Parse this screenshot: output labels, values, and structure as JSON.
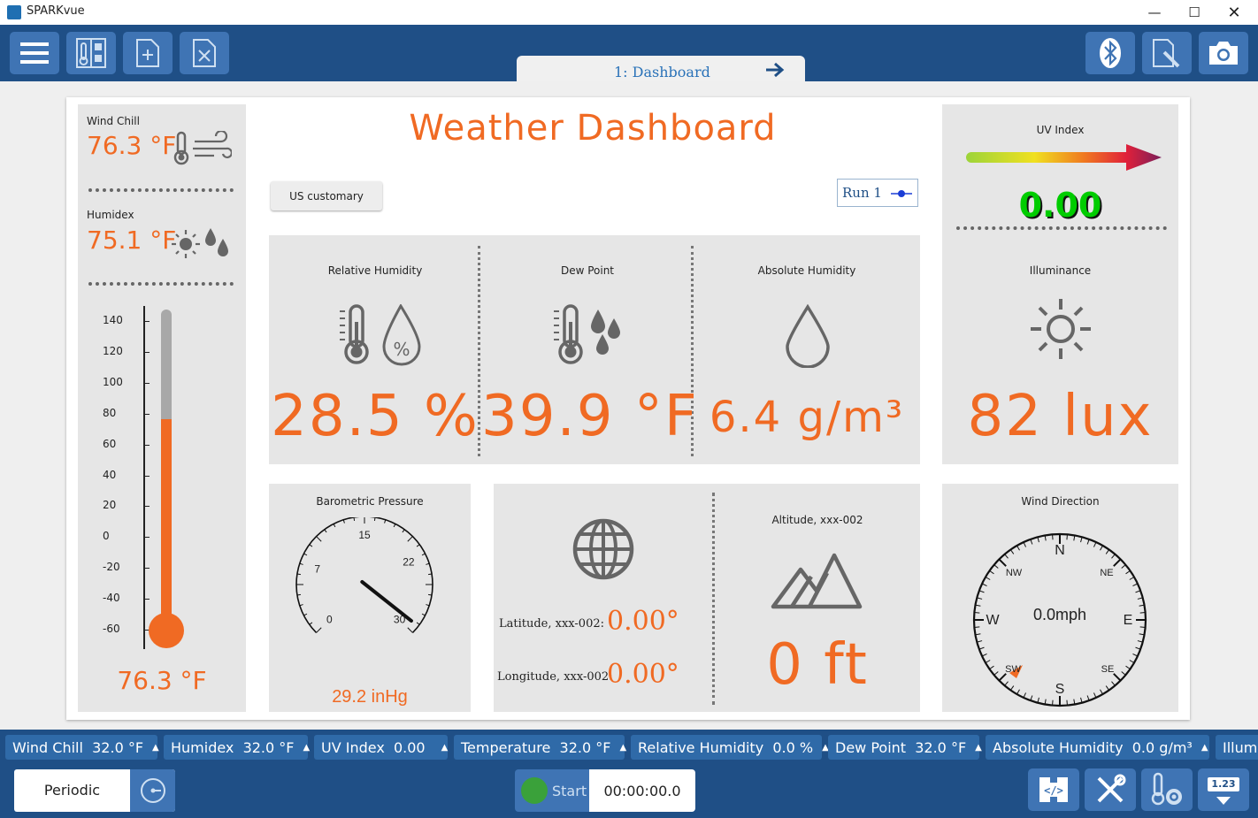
{
  "window": {
    "title": "SPARKvue"
  },
  "page_tab": {
    "label": "1: Dashboard"
  },
  "dashboard": {
    "title": "Weather Dashboard",
    "units_button": "US customary",
    "run_label": "Run 1"
  },
  "wind_chill": {
    "label": "Wind Chill",
    "value": "76.3 °F"
  },
  "humidex": {
    "label": "Humidex",
    "value": "75.1 °F"
  },
  "thermometer": {
    "ticks": [
      "140",
      "120",
      "100",
      "80",
      "60",
      "40",
      "20",
      "0",
      "-20",
      "-40",
      "-60"
    ],
    "fill_value": 76.3,
    "range": [
      -60,
      140
    ],
    "value": "76.3 °F"
  },
  "relative_humidity": {
    "label": "Relative Humidity",
    "value": "28.5 %"
  },
  "dew_point": {
    "label": "Dew Point",
    "value": "39.9 °F"
  },
  "absolute_humidity": {
    "label": "Absolute Humidity",
    "value": "6.4 g/m³"
  },
  "uv_index": {
    "label": "UV Index",
    "value": "0.00"
  },
  "illuminance": {
    "label": "Illuminance",
    "value": "82 lux"
  },
  "barometric": {
    "label": "Barometric Pressure",
    "ticks": [
      "0",
      "7",
      "15",
      "22",
      "30"
    ],
    "value": "29.2 inHg",
    "needle_value": 29.2,
    "range": [
      0,
      30
    ]
  },
  "location": {
    "latitude_label": "Latitude, xxx-002:",
    "latitude_value": "0.00°",
    "longitude_label": "Longitude, xxx-002:",
    "longitude_value": "0.00°"
  },
  "altitude": {
    "label": "Altitude, xxx-002",
    "value": "0 ft"
  },
  "wind_direction": {
    "label": "Wind Direction",
    "speed": "0.0mph",
    "directions": {
      "n": "N",
      "ne": "NE",
      "e": "E",
      "se": "SE",
      "s": "S",
      "sw": "SW",
      "w": "W",
      "nw": "NW"
    }
  },
  "live_bar": [
    {
      "label": "Wind Chill",
      "value": "32.0",
      "unit": "°F"
    },
    {
      "label": "Humidex",
      "value": "32.0",
      "unit": "°F"
    },
    {
      "label": "UV Index",
      "value": "0.00",
      "unit": ""
    },
    {
      "label": "Temperature",
      "value": "32.0",
      "unit": "°F"
    },
    {
      "label": "Relative Humidity",
      "value": "0.0",
      "unit": "%"
    },
    {
      "label": "Dew Point",
      "value": "32.0",
      "unit": "°F"
    },
    {
      "label": "Absolute Humidity",
      "value": "0.0",
      "unit": "g/m³"
    },
    {
      "label": "Illum",
      "value": "",
      "unit": ""
    }
  ],
  "bottom": {
    "mode": "Periodic",
    "start_label": "Start",
    "timer": "00:00:00.0",
    "meter_label": "1.23"
  },
  "colors": {
    "accent_orange": "#f06a23",
    "bar_blue": "#1f4f86",
    "button_blue": "#3f74b4",
    "uv_green": "#00cc00"
  }
}
